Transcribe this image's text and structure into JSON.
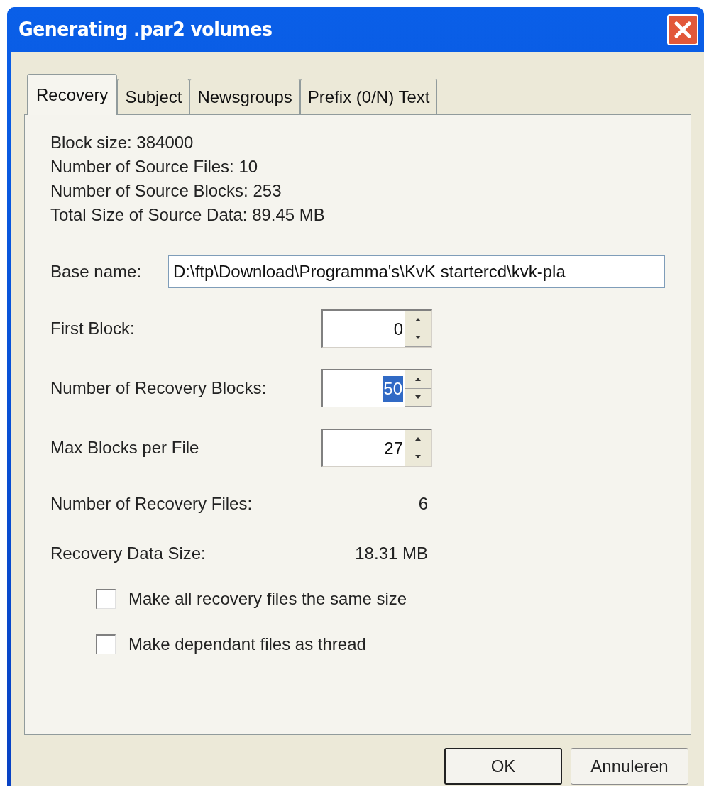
{
  "window": {
    "title": "Generating .par2 volumes"
  },
  "tabs": [
    {
      "label": "Recovery",
      "selected": true
    },
    {
      "label": "Subject",
      "selected": false
    },
    {
      "label": "Newsgroups",
      "selected": false
    },
    {
      "label": "Prefix (0/N) Text",
      "selected": false
    }
  ],
  "info": [
    "Block size: 384000",
    "Number of Source Files: 10",
    "Number of Source Blocks: 253",
    "Total Size of Source Data: 89.45 MB"
  ],
  "base_name": {
    "label": "Base name:",
    "value": "D:\\ftp\\Download\\Programma's\\KvK startercd\\kvk-pla"
  },
  "spinners": [
    {
      "label": "First Block:",
      "value": "0",
      "selected": false
    },
    {
      "label": "Number of Recovery Blocks:",
      "value": "50",
      "selected": true
    },
    {
      "label": "Max Blocks per File",
      "value": "27",
      "selected": false
    }
  ],
  "results": [
    {
      "label": "Number of Recovery Files:",
      "value": "6"
    },
    {
      "label": "Recovery Data Size:",
      "value": "18.31 MB"
    }
  ],
  "options": [
    {
      "label": "Make all recovery files the same size",
      "checked": false
    },
    {
      "label": "Make dependant files as thread",
      "checked": false
    }
  ],
  "buttons": [
    {
      "label": "OK",
      "default": true
    },
    {
      "label": "Annuleren",
      "default": false
    }
  ]
}
